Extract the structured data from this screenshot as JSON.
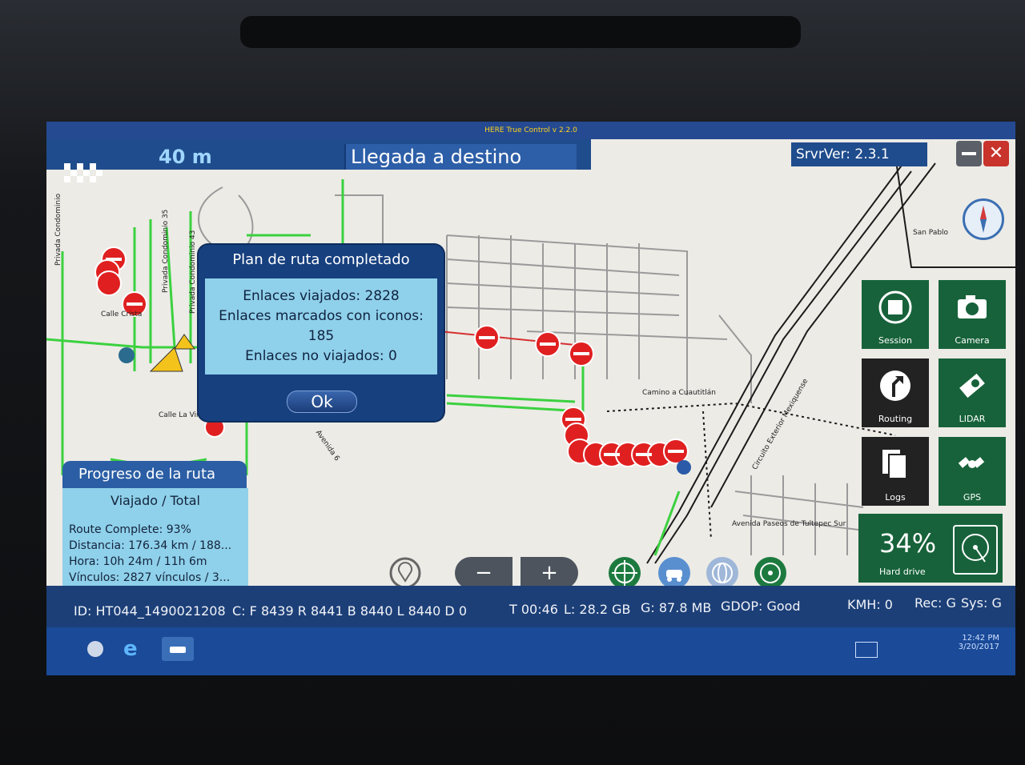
{
  "window": {
    "title": "HERE True Control v 2.2.0"
  },
  "header": {
    "distance": "40 m",
    "arrival_text": "Llegada a destino",
    "server_version": "SrvrVer: 2.3.1"
  },
  "dialog": {
    "title": "Plan de ruta completado",
    "lines": [
      "Enlaces viajados: 2828",
      "Enlaces marcados con iconos:",
      "185",
      "Enlaces no viajados: 0"
    ],
    "ok_label": "Ok"
  },
  "progress": {
    "title": "Progreso de la ruta",
    "subtitle": "Viajado / Total",
    "route_complete": "Route Complete: 93%",
    "distance": "Distancia: 176.34 km / 188...",
    "time": "Hora: 10h 24m / 11h 6m",
    "links": "Vínculos: 2827 vínculos / 3..."
  },
  "tiles": {
    "session": "Session",
    "camera": "Camera",
    "routing": "Routing",
    "lidar": "LIDAR",
    "logs": "Logs",
    "gps": "GPS",
    "hard_drive_pct": "34%",
    "hard_drive_label": "Hard drive"
  },
  "map_labels": {
    "priv1": "Privada Condominio",
    "priv35": "Privada Condominio 35",
    "priv43": "Privada Condominio 43",
    "calle_crista": "Calle Crista",
    "calle_la_vir": "Calle La Vir",
    "avenida6": "Avenida 6",
    "camino": "Camino a Cuautitlán",
    "circuito": "Circuito Exterior Mexiquense",
    "avenida_paseos": "Avenida Paseos de Tultepec Sur",
    "san_pablo": "San Pablo"
  },
  "status": {
    "id": "ID: HT044_1490021208",
    "counts": "C: F 8439 R 8441 B 8440 L 8440 D 0",
    "time": "T 00:46",
    "lidar_size": "L:  28.2 GB",
    "gps_size": "G:  87.8 MB",
    "gdop": "GDOP: Good",
    "kmh": "KMH: 0",
    "rec": "Rec: G",
    "sys": "Sys: G"
  },
  "taskbar": {
    "clock_time": "12:42 PM",
    "clock_date": "3/20/2017"
  },
  "colors": {
    "blue_panel": "#1f4c8c",
    "light_blue": "#8fd0ea",
    "tile_green": "#17623a",
    "road_green": "#3bd13f",
    "marker_red": "#e02020"
  }
}
